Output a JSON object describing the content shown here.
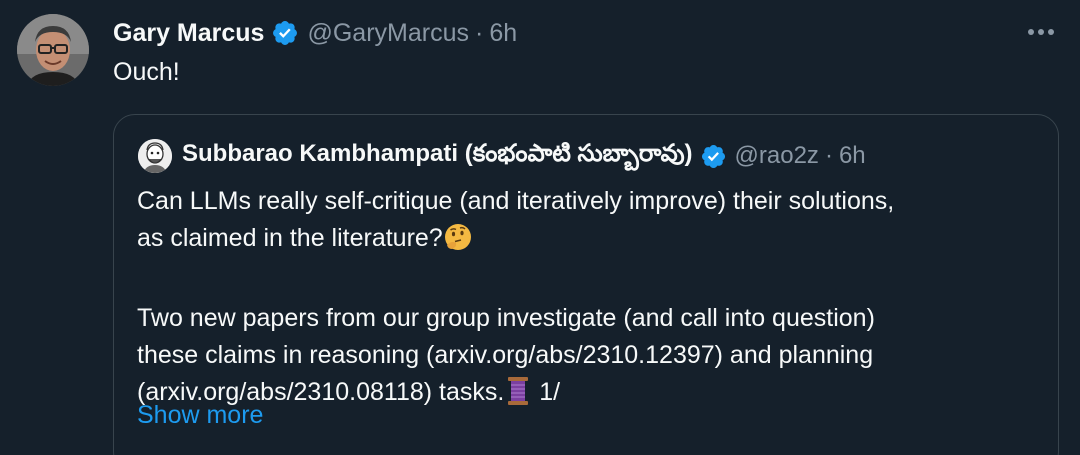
{
  "tweet": {
    "author_name": "Gary Marcus",
    "author_handle": "@GaryMarcus",
    "separator": "·",
    "time": "6h",
    "text": "Ouch!",
    "more_icon": "more-horizontal-icon",
    "verified_icon": "verified-badge-icon",
    "colors": {
      "background": "#15202b",
      "verified": "#1d9bf0",
      "secondary_text": "#8b98a5",
      "link": "#1d9bf0"
    }
  },
  "quote": {
    "author_name": "Subbarao Kambhampati (కంభంపాటి సుబ్బారావు)",
    "author_handle": "@rao2z",
    "separator": "·",
    "time": "6h",
    "line1": "Can LLMs really self-critique (and iteratively improve) their solutions,",
    "line2": "as claimed in the literature?",
    "emoji_thinking": "thinking-face-emoji",
    "line3": "Two new papers from our group investigate (and call into question)",
    "line4": "these claims in reasoning (arxiv.org/abs/2310.12397) and planning",
    "line5": "(arxiv.org/abs/2310.08118) tasks.",
    "emoji_thread": "thread-spool-emoji",
    "line5_suffix": " 1/",
    "show_more": "Show more"
  }
}
